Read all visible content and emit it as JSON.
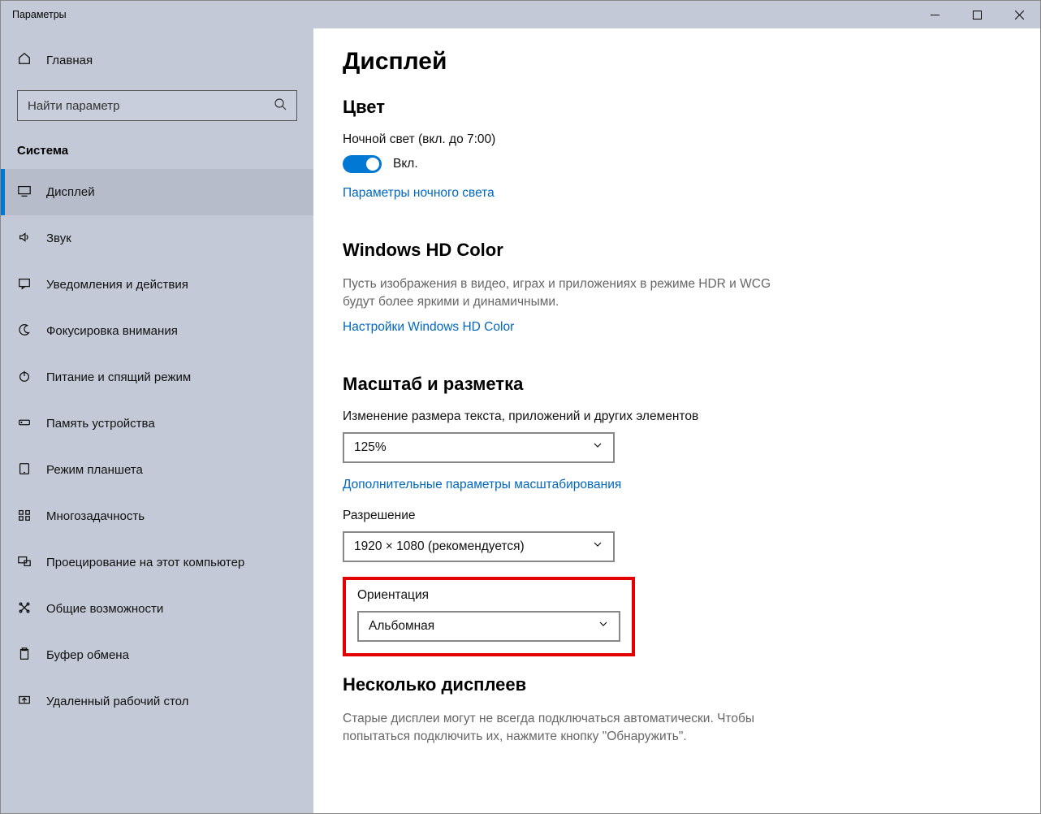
{
  "window": {
    "title": "Параметры"
  },
  "sidebar": {
    "home": "Главная",
    "search_placeholder": "Найти параметр",
    "section": "Система",
    "items": [
      {
        "label": "Дисплей",
        "active": true
      },
      {
        "label": "Звук"
      },
      {
        "label": "Уведомления и действия"
      },
      {
        "label": "Фокусировка внимания"
      },
      {
        "label": "Питание и спящий режим"
      },
      {
        "label": "Память устройства"
      },
      {
        "label": "Режим планшета"
      },
      {
        "label": "Многозадачность"
      },
      {
        "label": "Проецирование на этот компьютер"
      },
      {
        "label": "Общие возможности"
      },
      {
        "label": "Буфер обмена"
      },
      {
        "label": "Удаленный рабочий стол"
      }
    ]
  },
  "content": {
    "page_title": "Дисплей",
    "color_section": "Цвет",
    "night_light_label": "Ночной свет (вкл. до 7:00)",
    "toggle_state": "Вкл.",
    "night_light_link": "Параметры ночного света",
    "hdr_section": "Windows HD Color",
    "hdr_desc": "Пусть изображения в видео, играх и приложениях в режиме HDR и WCG будут более яркими и динамичными.",
    "hdr_link": "Настройки Windows HD Color",
    "scale_section": "Масштаб и разметка",
    "scale_label": "Изменение размера текста, приложений и других элементов",
    "scale_value": "125%",
    "scale_link": "Дополнительные параметры масштабирования",
    "resolution_label": "Разрешение",
    "resolution_value": "1920 × 1080 (рекомендуется)",
    "orientation_label": "Ориентация",
    "orientation_value": "Альбомная",
    "multi_section": "Несколько дисплеев",
    "multi_desc": "Старые дисплеи могут не всегда подключаться автоматически. Чтобы попытаться подключить их, нажмите кнопку \"Обнаружить\"."
  }
}
